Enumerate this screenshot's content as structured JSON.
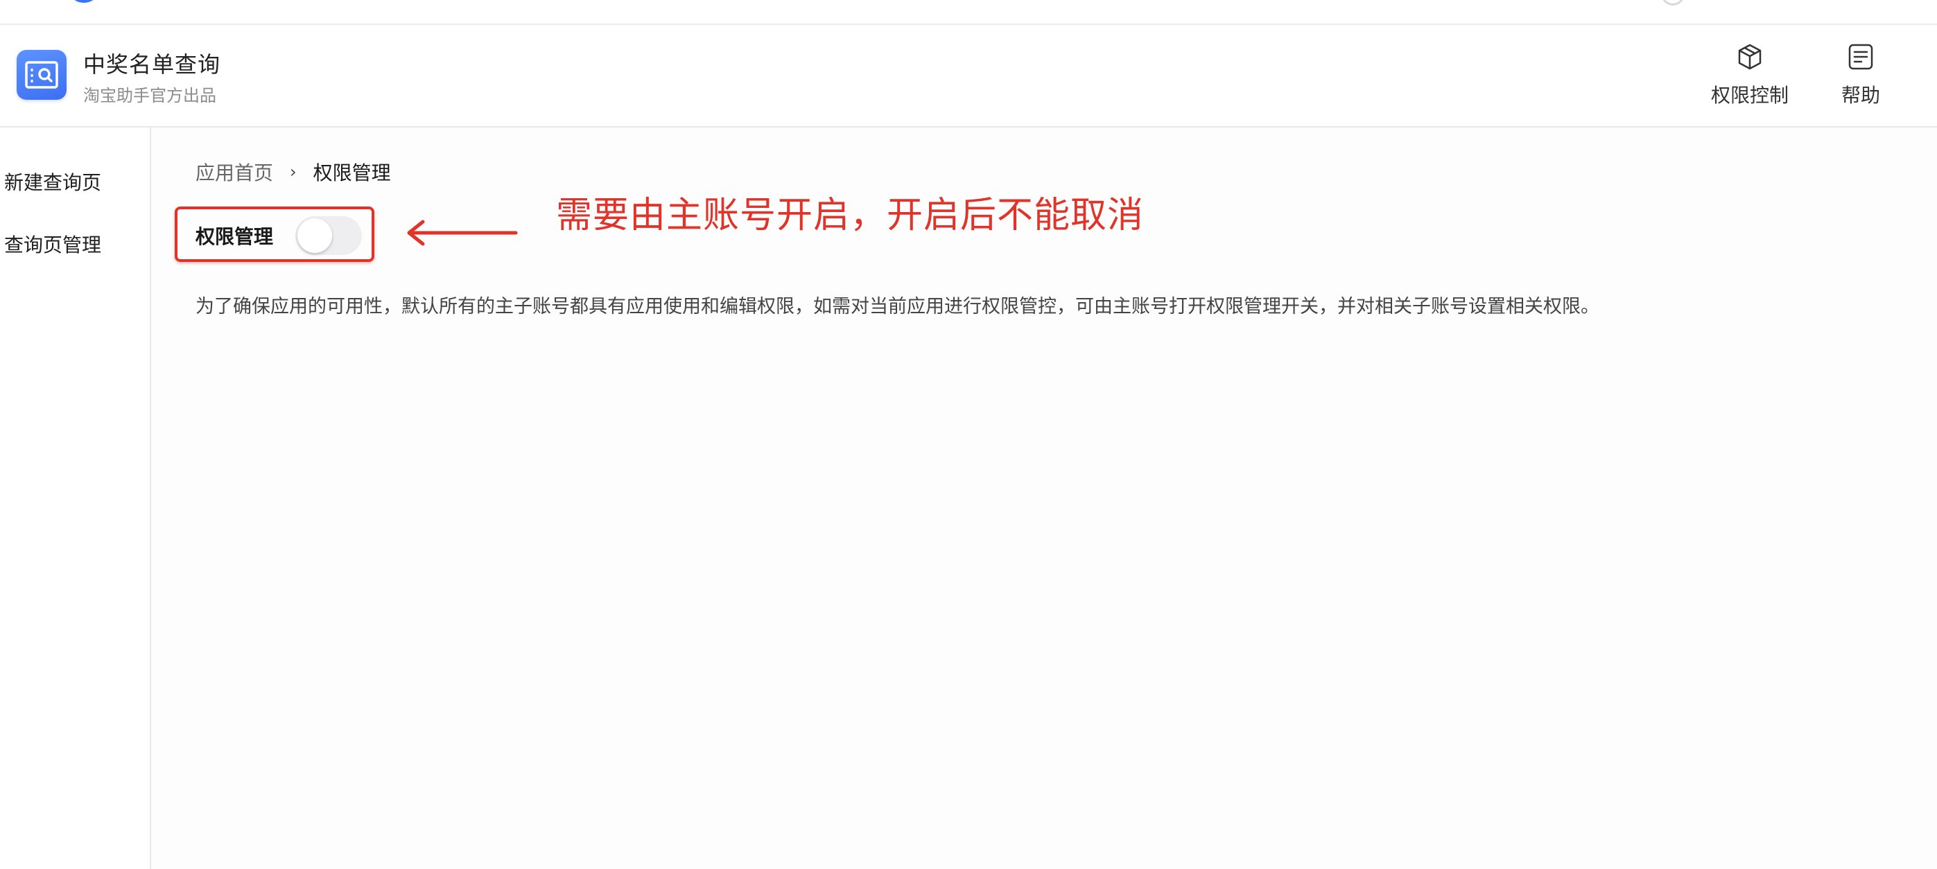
{
  "header": {
    "title": "中奖名单查询",
    "subtitle": "淘宝助手官方出品",
    "actions": [
      {
        "label": "权限控制",
        "icon": "cube-icon"
      },
      {
        "label": "帮助",
        "icon": "document-icon"
      }
    ]
  },
  "sidebar": {
    "items": [
      {
        "label": "新建查询页"
      },
      {
        "label": "查询页管理"
      }
    ]
  },
  "breadcrumb": {
    "home": "应用首页",
    "separator": "›",
    "current": "权限管理"
  },
  "permission_toggle": {
    "label": "权限管理",
    "enabled": false
  },
  "annotation": {
    "text": "需要由主账号开启，开启后不能取消",
    "color": "#e0332a"
  },
  "description": "为了确保应用的可用性，默认所有的主子账号都具有应用使用和编辑权限，如需对当前应用进行权限管控，可由主账号打开权限管理开关，并对相关子账号设置相关权限。",
  "colors": {
    "accent": "#3b74f5",
    "annotation_red": "#e0332a"
  }
}
